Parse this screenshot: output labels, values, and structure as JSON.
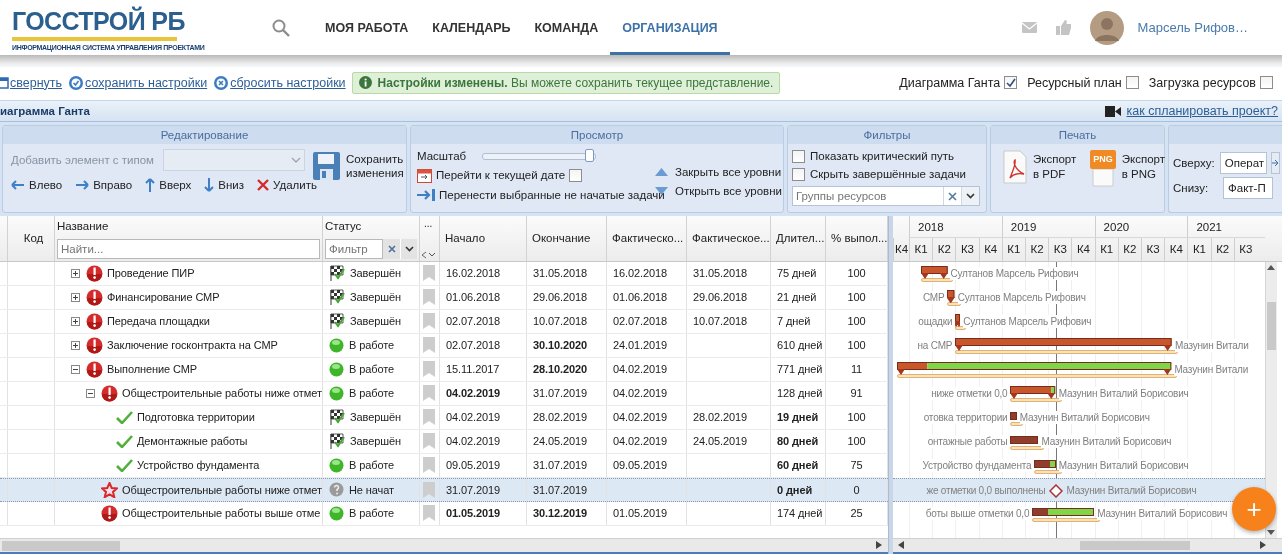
{
  "header": {
    "logo": {
      "title": "ГОССТРОЙ РБ",
      "subtitle": "ИНФОРМАЦИОННАЯ СИСТЕМА УПРАВЛЕНИЯ ПРОЕКТАМИ"
    },
    "nav": [
      {
        "label": "МОЯ РАБОТА",
        "selected": false
      },
      {
        "label": "КАЛЕНДАРЬ",
        "selected": false
      },
      {
        "label": "КОМАНДА",
        "selected": false
      },
      {
        "label": "ОРГАНИЗАЦИЯ",
        "selected": true
      }
    ],
    "user": {
      "name": "Марсель Рифов…"
    }
  },
  "toolbar": {
    "links": [
      {
        "label": "свернуть",
        "kind": "collapse"
      },
      {
        "label": "сохранить настройки",
        "kind": "save"
      },
      {
        "label": "сбросить настройки",
        "kind": "reset"
      }
    ],
    "notice": "**Настройки изменены.** Вы можете сохранить текущее представление.",
    "views": [
      {
        "label": "Диаграмма Ганта",
        "checked": true
      },
      {
        "label": "Ресурсный план",
        "checked": false
      },
      {
        "label": "Загрузка ресурсов",
        "checked": false
      }
    ]
  },
  "panel": {
    "title": "иаграмма Ганта",
    "help_link": "как спланировать проект?"
  },
  "ribbon": {
    "editing": {
      "title": "Редактирование",
      "add_element": {
        "label": "Добавить элемент с типом",
        "disabled": true
      },
      "actions": [
        {
          "label": "Влево",
          "kind": "left"
        },
        {
          "label": "Вправо",
          "kind": "right"
        },
        {
          "label": "Вверх",
          "kind": "up"
        },
        {
          "label": "Вниз",
          "kind": "down"
        },
        {
          "label": "Удалить",
          "kind": "delete"
        }
      ],
      "save": "Сохранить изменения"
    },
    "view": {
      "title": "Просмотр",
      "scale": {
        "label": "Масштаб",
        "level": 0.95
      },
      "go_today": {
        "label": "Перейти к текущей дате",
        "checked": false
      },
      "move_tasks": "Перенести выбранные не начатые задачи",
      "levels": [
        {
          "label": "Закрыть все уровни",
          "kind": "collapse"
        },
        {
          "label": "Открыть все уровни",
          "kind": "expand"
        }
      ]
    },
    "filters": {
      "title": "Фильтры",
      "options": [
        {
          "label": "Показать критический путь",
          "checked": false
        },
        {
          "label": "Скрыть завершённые задачи",
          "checked": false
        }
      ],
      "resource_groups": {
        "placeholder": "Группы ресурсов"
      }
    },
    "print": {
      "title": "Печать",
      "exports": [
        {
          "label": "Экспорт в PDF",
          "kind": "pdf"
        },
        {
          "label": "Экспорт в PNG",
          "kind": "png",
          "badge": "PNG"
        }
      ]
    },
    "layers": [
      {
        "label": "Сверху:",
        "value": "Операт"
      },
      {
        "label": "Снизу:",
        "value": "Факт-П"
      }
    ]
  },
  "grid": {
    "columns": [
      {
        "label": "Код"
      },
      {
        "label": "Название",
        "placeholder": "Найти..."
      },
      {
        "label": "Статус",
        "placeholder": "Фильтр"
      },
      {
        "label": "..."
      },
      {
        "label": "Начало"
      },
      {
        "label": "Окончание"
      },
      {
        "label": "Фактическо..."
      },
      {
        "label": "Фактическое..."
      },
      {
        "label": "Длител..."
      },
      {
        "label": "% выпол..."
      }
    ],
    "rows": [
      {
        "name": "Проведение ПИР",
        "expanded": false,
        "kind": "critical",
        "status": {
          "label": "Завершён",
          "kind": "done"
        },
        "start": "16.02.2018",
        "end": "31.05.2018",
        "actual_start": "16.02.2018",
        "actual_end": "31.05.2018",
        "duration": "75 дней",
        "percent": "100",
        "start_bold": false,
        "end_bold": false,
        "duration_bold": false,
        "selected": false,
        "gantt": {
          "resource": "Султанов Марсель Рифович"
        }
      },
      {
        "name": "Финансирование СМР",
        "expanded": false,
        "kind": "critical",
        "status": {
          "label": "Завершён",
          "kind": "done"
        },
        "start": "01.06.2018",
        "end": "29.06.2018",
        "actual_start": "01.06.2018",
        "actual_end": "29.06.2018",
        "duration": "21 дней",
        "percent": "100",
        "start_bold": false,
        "end_bold": false,
        "duration_bold": false,
        "selected": false,
        "gantt": {
          "label": "СМР",
          "resource": "Султанов Марсель Рифович"
        }
      },
      {
        "name": "Передача площадки",
        "expanded": false,
        "kind": "critical",
        "status": {
          "label": "Завершён",
          "kind": "done"
        },
        "start": "02.07.2018",
        "end": "10.07.2018",
        "actual_start": "02.07.2018",
        "actual_end": "10.07.2018",
        "duration": "7 дней",
        "percent": "100",
        "start_bold": false,
        "end_bold": false,
        "duration_bold": false,
        "selected": false,
        "gantt": {
          "label": "ощадки",
          "resource": "Султанов Марсель Рифович"
        }
      },
      {
        "name": "Заключение госконтракта на СМР",
        "expanded": false,
        "kind": "critical",
        "status": {
          "label": "В работе",
          "kind": "in_progress"
        },
        "start": "02.07.2018",
        "end": "30.10.2020",
        "actual_start": "24.01.2019",
        "duration": "610 дней",
        "percent": "100",
        "start_bold": false,
        "end_bold": true,
        "duration_bold": false,
        "selected": false,
        "gantt": {
          "label": "на СМР",
          "resource": "Мазунин Витали"
        }
      },
      {
        "name": "Выполнение СМР",
        "expanded": true,
        "kind": "critical",
        "status": {
          "label": "В работе",
          "kind": "in_progress"
        },
        "start": "15.11.2017",
        "end": "28.10.2020",
        "actual_start": "04.02.2019",
        "duration": "771 дней",
        "percent": "11",
        "start_bold": false,
        "end_bold": true,
        "duration_bold": false,
        "selected": false,
        "gantt": {
          "resource": "Мазунин Витали"
        },
        "children": [
          {
            "name": "Общестроительные работы ниже отмет",
            "expanded": true,
            "kind": "critical",
            "status": {
              "label": "В работе",
              "kind": "in_progress"
            },
            "start": "04.02.2019",
            "end": "31.07.2019",
            "actual_start": "04.02.2019",
            "duration": "128 дней",
            "percent": "91",
            "start_bold": true,
            "end_bold": false,
            "duration_bold": false,
            "selected": false,
            "gantt": {
              "label": "ниже отметки 0,0",
              "resource": "Мазунин Виталий Борисович"
            },
            "children": [
              {
                "name": "Подготовка территории",
                "kind": "done",
                "status": {
                  "label": "Завершён",
                  "kind": "done"
                },
                "start": "04.02.2019",
                "end": "28.02.2019",
                "actual_start": "04.02.2019",
                "actual_end": "28.02.2019",
                "duration": "19 дней",
                "percent": "100",
                "start_bold": false,
                "end_bold": false,
                "duration_bold": true,
                "selected": false,
                "gantt": {
                  "label": "отовка территории",
                  "resource": "Мазунин Виталий Борисович"
                }
              },
              {
                "name": "Демонтажные работы",
                "kind": "done",
                "status": {
                  "label": "Завершён",
                  "kind": "done"
                },
                "start": "04.02.2019",
                "end": "24.05.2019",
                "actual_start": "04.02.2019",
                "actual_end": "24.05.2019",
                "duration": "80 дней",
                "percent": "100",
                "start_bold": false,
                "end_bold": false,
                "duration_bold": true,
                "selected": false,
                "gantt": {
                  "label": "онтажные работы",
                  "resource": "Мазунин Виталий Борисович"
                }
              },
              {
                "name": "Устройство фундамента",
                "kind": "done",
                "status": {
                  "label": "В работе",
                  "kind": "in_progress"
                },
                "start": "09.05.2019",
                "end": "31.07.2019",
                "actual_start": "09.05.2019",
                "duration": "60 дней",
                "percent": "75",
                "start_bold": false,
                "end_bold": false,
                "duration_bold": true,
                "selected": false,
                "gantt": {
                  "label": "Устройство фундамента",
                  "resource": "Мазунин Виталий Борисович"
                }
              }
            ]
          },
          {
            "name": "Общестроительные работы ниже отмет",
            "kind": "milestone",
            "status": {
              "label": "Не начат",
              "kind": "not_started"
            },
            "start": "31.07.2019",
            "end": "31.07.2019",
            "duration": "0 дней",
            "percent": "0",
            "start_bold": false,
            "end_bold": false,
            "duration_bold": true,
            "selected": true,
            "gantt": {
              "label": "же отметки 0,0 выполнены",
              "resource": "Мазунин Виталий Борисович"
            }
          },
          {
            "name": "Общестроительные работы выше отме",
            "kind": "critical",
            "status": {
              "label": "В работе",
              "kind": "in_progress"
            },
            "start": "01.05.2019",
            "end": "30.12.2019",
            "actual_start": "01.05.2019",
            "duration": "174 дней",
            "percent": "25",
            "start_bold": true,
            "end_bold": true,
            "duration_bold": false,
            "selected": false,
            "gantt": {
              "label": "боты выше отметки 0,0",
              "resource": "Мазунин Виталий Борисович"
            }
          }
        ]
      }
    ]
  },
  "gantt": {
    "years": [
      "2018",
      "2019",
      "2020",
      "2021"
    ],
    "quarters": [
      "К4",
      "К1",
      "К2",
      "К3",
      "К4",
      "К1",
      "К2",
      "К3",
      "К4",
      "К1",
      "К2",
      "К3",
      "К4",
      "К1",
      "К2",
      "К3"
    ]
  },
  "fab": "+"
}
